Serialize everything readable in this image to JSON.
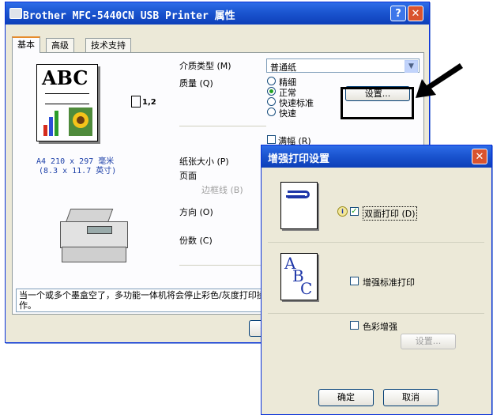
{
  "main_window": {
    "title": "Brother MFC-5440CN USB Printer 属性",
    "help_button": "?",
    "close_button": "✕",
    "tabs": [
      {
        "label": "基本"
      },
      {
        "label": "高级"
      },
      {
        "label": "技术支持"
      }
    ],
    "preview": {
      "letters": "ABC",
      "pages_label": "1,2",
      "paper_desc_line1": "A4 210 x 297 毫米",
      "paper_desc_line2": "(8.3 x 11.7 英寸)"
    },
    "media_type": {
      "label": "介质类型 (M)",
      "value": "普通纸"
    },
    "quality": {
      "label": "质量 (Q)",
      "options": [
        "精细",
        "正常",
        "快速标准",
        "快速"
      ],
      "selected": "正常"
    },
    "settings_button": "设置...",
    "borderless": {
      "label": "满幅 (R)",
      "checked": false
    },
    "paper_size": {
      "label": "纸张大小 (P)"
    },
    "page_label": "页面",
    "border_line": "边框线 (B)",
    "orientation": "方向 (O)",
    "copies": "份数 (C)",
    "status_message": "当一个或多个墨盒空了，多功能一体机将会停止彩色/灰度打印操作。",
    "ok_button_partial": "确"
  },
  "dialog": {
    "title": "增强打印设置",
    "close_button": "✕",
    "duplex": {
      "label": "双面打印 (D)",
      "checked": true
    },
    "enhanced_normal": {
      "label": "增强标准打印",
      "checked": false
    },
    "color_enhance": {
      "label": "色彩增强",
      "checked": false
    },
    "settings_button": "设置...",
    "ok_button": "确定",
    "cancel_button": "取消",
    "sample_letters": [
      "A",
      "B",
      "C"
    ]
  },
  "accent_colors": {
    "titlebar": "#1b55d0",
    "close": "#d9532e",
    "window_bg": "#ece9d8"
  }
}
